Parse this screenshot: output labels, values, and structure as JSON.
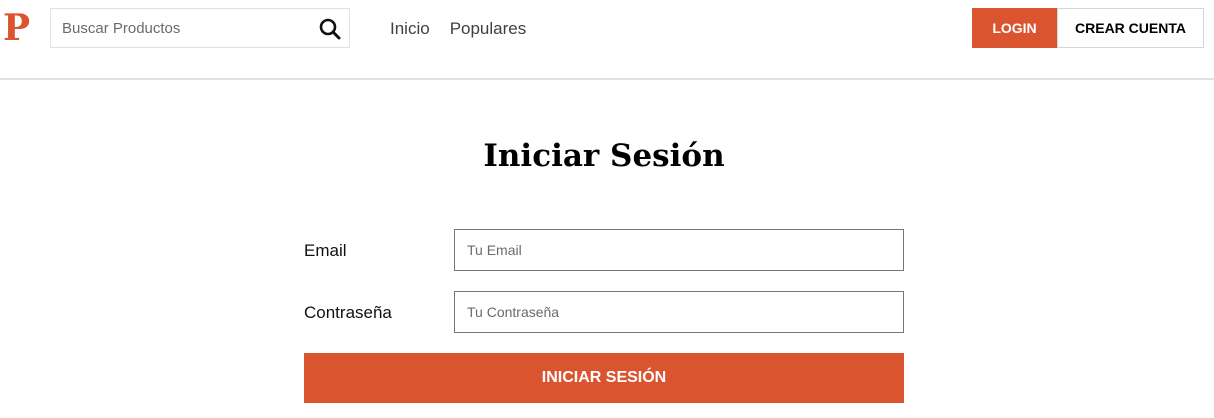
{
  "header": {
    "logo_text": "P",
    "search": {
      "placeholder": "Buscar Productos",
      "value": "",
      "icon": "search-icon"
    },
    "nav": [
      {
        "label": "Inicio"
      },
      {
        "label": "Populares"
      }
    ],
    "login_label": "LOGIN",
    "create_account_label": "CREAR CUENTA"
  },
  "main": {
    "title": "Iniciar Sesión",
    "form": {
      "email_label": "Email",
      "email_placeholder": "Tu Email",
      "password_label": "Contraseña",
      "password_placeholder": "Tu Contraseña",
      "submit_label": "INICIAR SESIÓN"
    }
  },
  "colors": {
    "accent": "#da552f",
    "border": "#e1e1e1"
  }
}
